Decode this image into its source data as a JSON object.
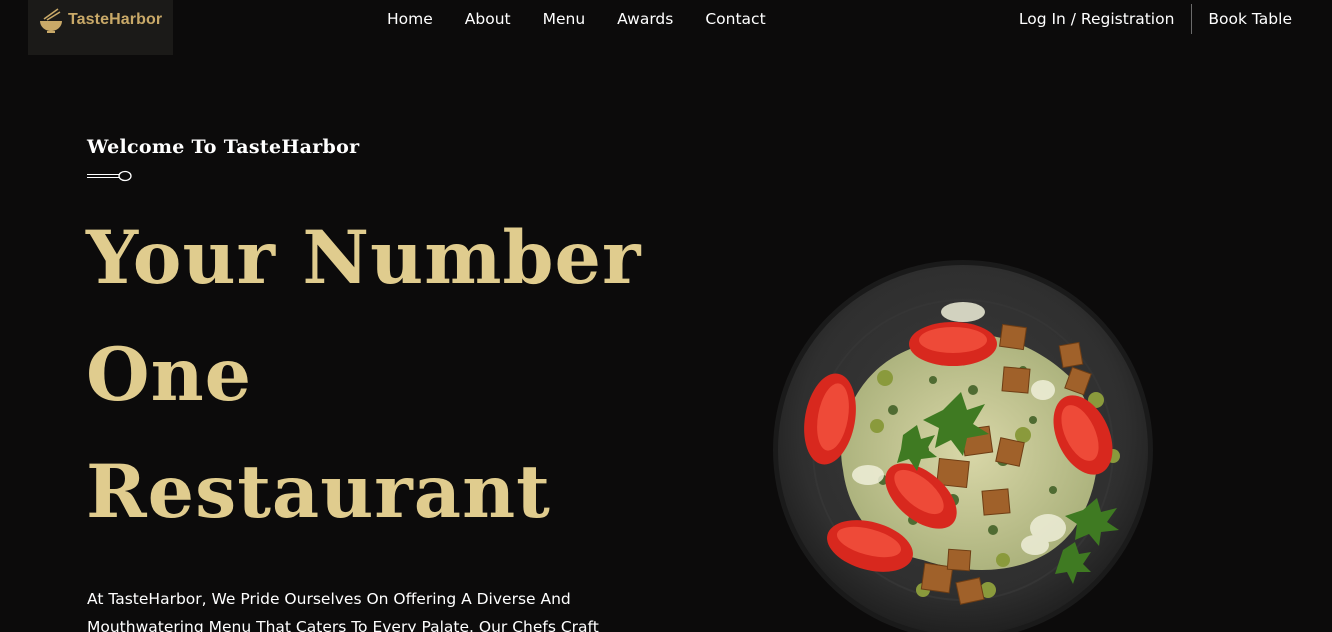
{
  "header": {
    "logo_text": "TasteHarbor",
    "logo_icon": "bowl-with-chopsticks-icon",
    "nav": [
      {
        "label": "Home"
      },
      {
        "label": "About"
      },
      {
        "label": "Menu"
      },
      {
        "label": "Awards"
      },
      {
        "label": "Contact"
      }
    ],
    "login_label": "Log In / Registration",
    "book_label": "Book Table"
  },
  "hero": {
    "welcome": "Welcome To TasteHarbor",
    "headline_lines": [
      "Your Number",
      "One",
      "Restaurant"
    ],
    "description": "At TasteHarbor, We Pride Ourselves On Offering A Diverse And Mouthwatering Menu That Caters To Every Palate. Our Chefs Craft",
    "image_subject": "salad-plate-icon"
  },
  "colors": {
    "background": "#0c0b0b",
    "accent_gold": "#e0cc8e",
    "logo_gold": "#c9a968",
    "text": "#ffffff"
  }
}
